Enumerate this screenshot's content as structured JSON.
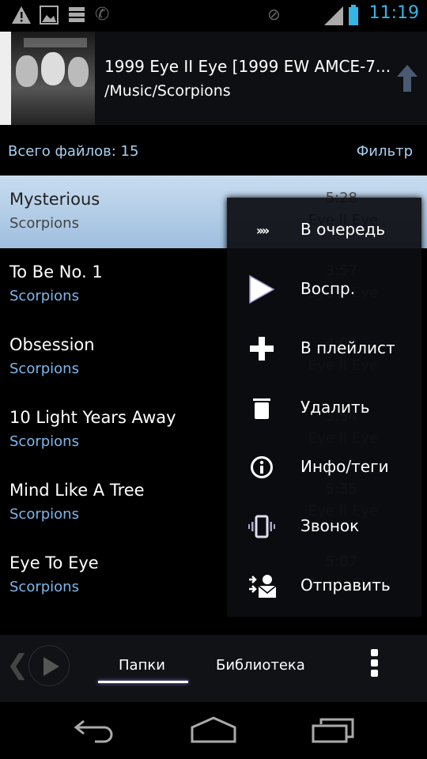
{
  "status_bar": {
    "time": "11:19",
    "icons": [
      "warning-icon",
      "image-icon",
      "storage-icon",
      "phone-wifi-icon",
      "mute-icon",
      "signal-icon",
      "battery-icon"
    ]
  },
  "now_playing": {
    "title": "1999 Eye II Eye [1999 EW AMCE-7...",
    "path": "/Music/Scorpions"
  },
  "file_count": "Всего файлов: 15",
  "filter_label": "Фильтр",
  "tracks": [
    {
      "title": "Mysterious",
      "artist": "Scorpions",
      "duration": "5:28",
      "album": "Eye II Eye",
      "selected": true
    },
    {
      "title": "To Be No. 1",
      "artist": "Scorpions",
      "duration": "3:57",
      "album": "Eye II Eye"
    },
    {
      "title": "Obsession",
      "artist": "Scorpions",
      "duration": "4:00",
      "album": "Eye II Eye"
    },
    {
      "title": "10 Light Years Away",
      "artist": "Scorpions",
      "duration": "3:54",
      "album": "Eye II Eye"
    },
    {
      "title": "Mind Like A Tree",
      "artist": "Scorpions",
      "duration": "5:35",
      "album": "Eye II Eye"
    },
    {
      "title": "Eye To Eye",
      "artist": "Scorpions",
      "duration": "5:07",
      "album": "Eye II Eye"
    }
  ],
  "context_menu": [
    {
      "label": "В очередь",
      "icon": "queue-icon"
    },
    {
      "label": "Воспр.",
      "icon": "play-icon"
    },
    {
      "label": "В плейлист",
      "icon": "plus-icon"
    },
    {
      "label": "Удалить",
      "icon": "trash-icon"
    },
    {
      "label": "Инфо/теги",
      "icon": "info-icon"
    },
    {
      "label": "Звонок",
      "icon": "ringtone-icon"
    },
    {
      "label": "Отправить",
      "icon": "send-icon"
    }
  ],
  "bottom_tabs": {
    "folders": "Папки",
    "library": "Библиотека",
    "active": "Папки"
  },
  "accent_color": "#33b5e5"
}
